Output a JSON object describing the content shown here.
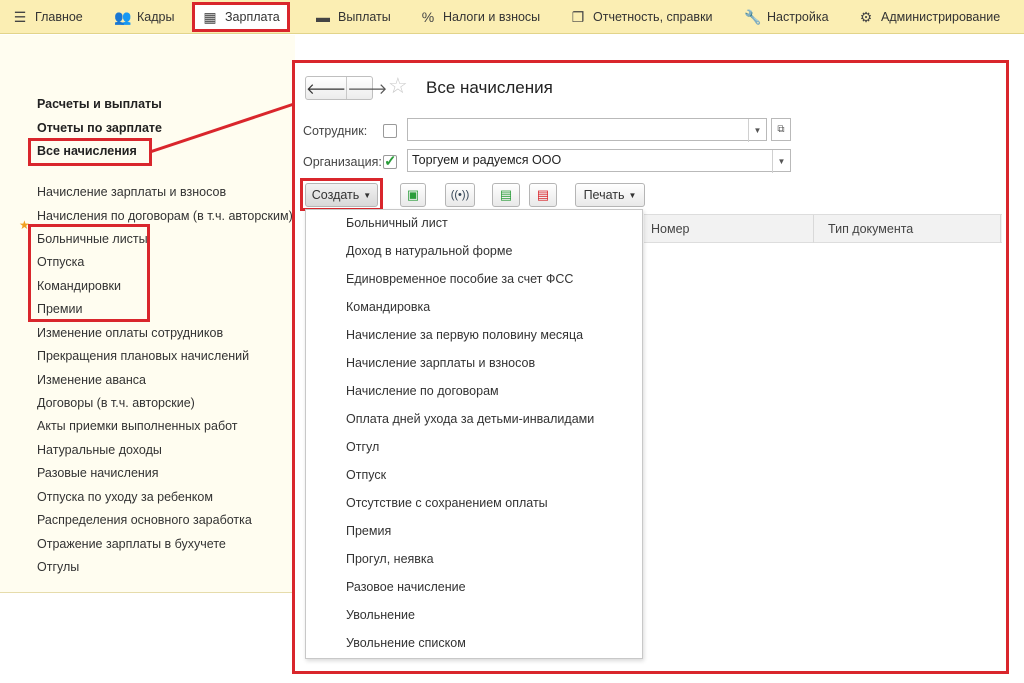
{
  "menu": [
    {
      "label": "Главное",
      "icon": "hamburger-icon"
    },
    {
      "label": "Кадры",
      "icon": "people-icon"
    },
    {
      "label": "Зарплата",
      "icon": "calculator-icon"
    },
    {
      "label": "Выплаты",
      "icon": "wallet-icon"
    },
    {
      "label": "Налоги и взносы",
      "icon": "percent-icon"
    },
    {
      "label": "Отчетность, справки",
      "icon": "documents-icon"
    },
    {
      "label": "Настройка",
      "icon": "wrench-icon"
    },
    {
      "label": "Администрирование",
      "icon": "gear-icon"
    }
  ],
  "sidebar": {
    "headings": [
      "Расчеты и выплаты",
      "Отчеты по зарплате",
      "Все начисления"
    ],
    "links": [
      "Начисление зарплаты и взносов",
      "Начисления по договорам (в т.ч. авторским)",
      "Больничные листы",
      "Отпуска",
      "Командировки",
      "Премии",
      "Изменение оплаты сотрудников",
      "Прекращения плановых начислений",
      "Изменение аванса",
      "Договоры (в т.ч. авторские)",
      "Акты приемки выполненных работ",
      "Натуральные доходы",
      "Разовые начисления",
      "Отпуска по уходу за ребенком",
      "Распределения основного заработка",
      "Отражение зарплаты в бухучете",
      "Отгулы"
    ]
  },
  "form": {
    "title": "Все начисления",
    "employee_label": "Сотрудник:",
    "employee_value": "",
    "org_label": "Организация:",
    "org_value": "Торгуем и радуемся ООО"
  },
  "toolbar": {
    "create_label": "Создать",
    "print_label": "Печать"
  },
  "grid": {
    "columns": [
      "Номер",
      "Тип документа"
    ]
  },
  "create_menu": [
    "Больничный лист",
    "Доход в натуральной форме",
    "Единовременное пособие за счет ФСС",
    "Командировка",
    "Начисление за первую половину месяца",
    "Начисление зарплаты и взносов",
    "Начисление по договорам",
    "Оплата дней ухода за детьми-инвалидами",
    "Отгул",
    "Отпуск",
    "Отсутствие с сохранением оплаты",
    "Премия",
    "Прогул, неявка",
    "Разовое начисление",
    "Увольнение",
    "Увольнение списком"
  ],
  "colors": {
    "highlight": "#d9262c",
    "menu_bg": "#fbeeb3",
    "sidebar_bg": "#fffdf0"
  }
}
